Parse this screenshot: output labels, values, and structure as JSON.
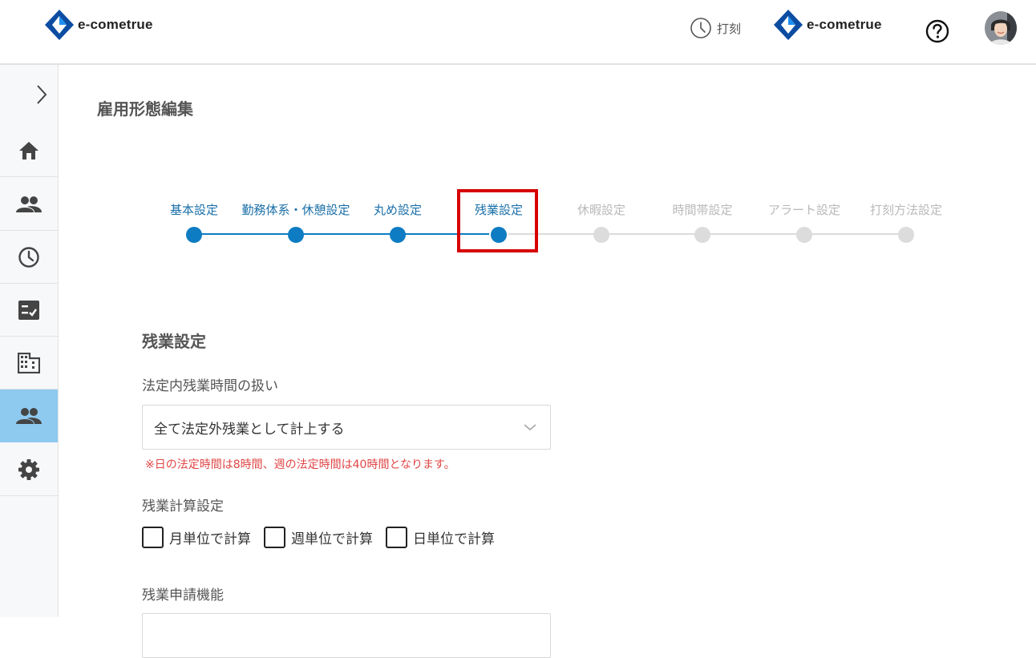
{
  "header": {
    "logo_text": "e-cometrue",
    "punch_label": "打刻",
    "brand_logo_text": "e-cometrue"
  },
  "sidebar": {
    "items": [
      {
        "icon": "home-icon"
      },
      {
        "icon": "people-icon"
      },
      {
        "icon": "clock-icon"
      },
      {
        "icon": "checklist-icon"
      },
      {
        "icon": "building-icon"
      },
      {
        "icon": "people-icon",
        "active": true
      },
      {
        "icon": "gear-icon"
      }
    ]
  },
  "page": {
    "title": "雇用形態編集"
  },
  "stepper": {
    "steps": [
      {
        "label": "基本設定",
        "state": "done"
      },
      {
        "label": "勤務体系・休憩設定",
        "state": "done"
      },
      {
        "label": "丸め設定",
        "state": "done"
      },
      {
        "label": "残業設定",
        "state": "current"
      },
      {
        "label": "休暇設定",
        "state": "todo"
      },
      {
        "label": "時間帯設定",
        "state": "todo"
      },
      {
        "label": "アラート設定",
        "state": "todo"
      },
      {
        "label": "打刻方法設定",
        "state": "todo"
      }
    ]
  },
  "form": {
    "section_title": "残業設定",
    "legal_overtime_label": "法定内残業時間の扱い",
    "legal_overtime_value": "全て法定外残業として計上する",
    "legal_note": "※日の法定時間は8時間、週の法定時間は40時間となります。",
    "calc_label": "残業計算設定",
    "calc_options": [
      "月単位で計算",
      "週単位で計算",
      "日単位で計算"
    ],
    "request_label": "残業申請機能"
  },
  "colors": {
    "accent": "#0d7cc2",
    "sidebar_active": "#8ec9f0",
    "note_red": "#e04646",
    "highlight": "#d60000"
  }
}
